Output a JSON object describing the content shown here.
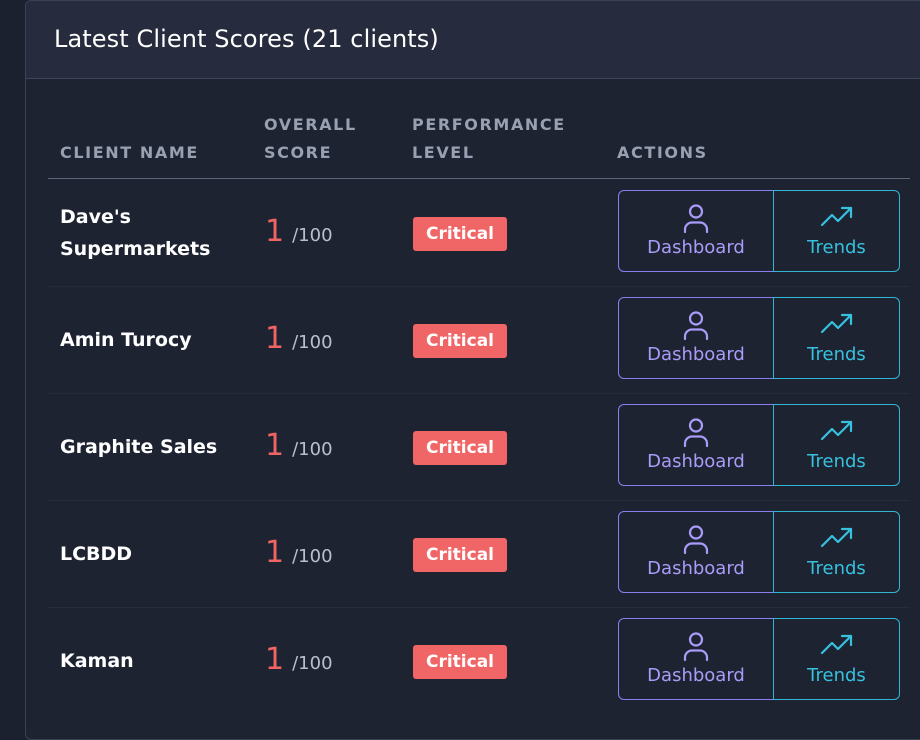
{
  "card": {
    "title": "Latest Client Scores (21 clients)"
  },
  "table": {
    "headers": {
      "client_name": "CLIENT NAME",
      "overall_score_line1": "OVERALL",
      "overall_score_line2": "SCORE",
      "performance_level_line1": "PERFORMANCE",
      "performance_level_line2": "LEVEL",
      "actions": "ACTIONS"
    },
    "rows": [
      {
        "client_line1": "Dave's",
        "client_line2": "Supermarkets",
        "score": "1",
        "score_max": "/100",
        "level": "Critical",
        "dashboard_label": "Dashboard",
        "trends_label": "Trends"
      },
      {
        "client_line1": "Amin Turocy",
        "client_line2": "",
        "score": "1",
        "score_max": "/100",
        "level": "Critical",
        "dashboard_label": "Dashboard",
        "trends_label": "Trends"
      },
      {
        "client_line1": "Graphite Sales",
        "client_line2": "",
        "score": "1",
        "score_max": "/100",
        "level": "Critical",
        "dashboard_label": "Dashboard",
        "trends_label": "Trends"
      },
      {
        "client_line1": "LCBDD",
        "client_line2": "",
        "score": "1",
        "score_max": "/100",
        "level": "Critical",
        "dashboard_label": "Dashboard",
        "trends_label": "Trends"
      },
      {
        "client_line1": "Kaman",
        "client_line2": "",
        "score": "1",
        "score_max": "/100",
        "level": "Critical",
        "dashboard_label": "Dashboard",
        "trends_label": "Trends"
      }
    ]
  },
  "icons": {
    "dashboard": "user-icon",
    "trends": "trending-up-icon"
  },
  "colors": {
    "critical": "#f06565",
    "score": "#f16464",
    "dashboard_accent": "#a99cf8",
    "trends_accent": "#36c2de"
  }
}
